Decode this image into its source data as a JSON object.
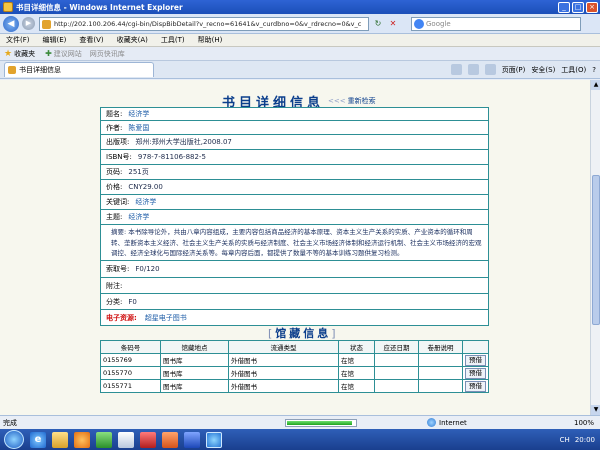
{
  "window": {
    "title": "书目详细信息 - Windows Internet Explorer",
    "min": "_",
    "max": "□",
    "close": "×"
  },
  "address": {
    "back": "◀",
    "forward": "▶",
    "url": "http://202.100.206.44/cgi-bin/DispBibDetail?v_recno=61641&v_curdbno=0&v_rdrecno=0&v_c",
    "refresh": "↻",
    "stop": "✕",
    "search_placeholder": "Google"
  },
  "menu": [
    "文件(F)",
    "编辑(E)",
    "查看(V)",
    "收藏夹(A)",
    "工具(T)",
    "帮助(H)"
  ],
  "favorites": {
    "label": "收藏夹",
    "suggested": "建议网站",
    "webslice": "网页快讯库"
  },
  "tab": {
    "label": "书目详细信息"
  },
  "toolbar": {
    "page": "页面(P)",
    "safety": "安全(S)",
    "tools": "工具(O)",
    "help": "?"
  },
  "page": {
    "heading": "书目详细信息",
    "research_arrows": "<<<",
    "research_link": "重新检索",
    "fields": {
      "title_label": "题名:",
      "title_value": "经济学",
      "author_label": "作者:",
      "author_value": "陈爱国",
      "publish_label": "出版项:",
      "publish_value": "郑州:郑州大学出版社,2008.07",
      "isbn_label": "ISBN号:",
      "isbn_value": "978-7-81106-882-5",
      "pages_label": "页码:",
      "pages_value": "251页",
      "price_label": "价格:",
      "price_value": "CNY29.00",
      "keyword_label": "关键词:",
      "keyword_value": "经济学",
      "subject_label": "主题:",
      "subject_value": "经济学",
      "abstract_label": "摘要:",
      "abstract_value": "本书除导论外，共由八章内容组成，主要内容包括商品经济的基本原理、资本主义生产关系的实质、产业资本的循环和周转、垄断资本主义经济、社会主义生产关系的实质与经济制度、社会主义市场经济体制和经济运行机制、社会主义市场经济的宏观调控、经济全球化与国际经济关系等。每章内容后面，都提供了数量不等的基本训练习题供复习检测。",
      "callno_label": "索取号:",
      "callno_value": "F0/120",
      "attach_label": "附注:",
      "attach_value": "",
      "class_label": "分类:",
      "class_value": "F0",
      "eres_label": "电子资源:",
      "eres_value": "超星电子图书"
    },
    "holdings_heading": "馆藏信息",
    "holdings_bracket_left": "[",
    "holdings_bracket_right": "]",
    "holdings_columns": [
      "条码号",
      "馆藏地点",
      "流通类型",
      "状态",
      "应还日期",
      "卷册说明",
      ""
    ],
    "holdings_rows": [
      {
        "barcode": "0155769",
        "location": "图书库",
        "type": "外借图书",
        "status": "在馆",
        "due": "",
        "vol": "",
        "action": "预借"
      },
      {
        "barcode": "0155770",
        "location": "图书库",
        "type": "外借图书",
        "status": "在馆",
        "due": "",
        "vol": "",
        "action": "预借"
      },
      {
        "barcode": "0155771",
        "location": "图书库",
        "type": "外借图书",
        "status": "在馆",
        "due": "",
        "vol": "",
        "action": "预借"
      }
    ]
  },
  "status": {
    "done": "完成",
    "progress_fraction": 0.95,
    "zone": "Internet",
    "zoom": "100%"
  },
  "taskbar": {
    "ie_letter": "e",
    "clock": "20:00",
    "tray_lang": "CH"
  }
}
